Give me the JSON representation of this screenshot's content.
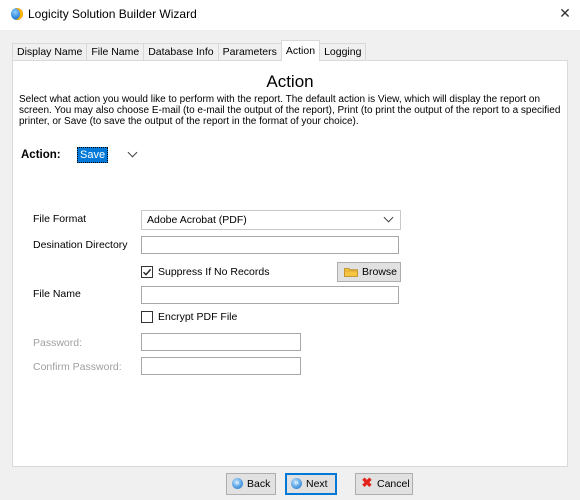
{
  "window": {
    "title": "Logicity Solution Builder Wizard",
    "close_label": "✕"
  },
  "tabs": [
    {
      "label": "Display Name",
      "active": false
    },
    {
      "label": "File Name",
      "active": false
    },
    {
      "label": "Database Info",
      "active": false
    },
    {
      "label": "Parameters",
      "active": false
    },
    {
      "label": "Action",
      "active": true
    },
    {
      "label": "Logging",
      "active": false
    }
  ],
  "panel": {
    "heading": "Action",
    "description": "Select what action you would like to perform with the report.  The default action is View, which will display the report on screen. You may also choose E-mail (to e-mail the output of the report), Print (to print the output of the report to a specified printer, or Save (to save the output of the report in the format of your choice)."
  },
  "action": {
    "label": "Action:",
    "selected": "Save"
  },
  "file_format": {
    "label": "File Format",
    "selected": "Adobe Acrobat (PDF)"
  },
  "destination_directory": {
    "label": "Desination Directory",
    "value": ""
  },
  "suppress": {
    "label": "Suppress If No Records",
    "checked": true
  },
  "browse": {
    "label": "Browse"
  },
  "file_name": {
    "label": "File Name",
    "value": ""
  },
  "encrypt": {
    "label": "Encrypt PDF File",
    "checked": false
  },
  "password": {
    "label": "Password:",
    "value": ""
  },
  "confirm_password": {
    "label": "Confirm Password:",
    "value": ""
  },
  "buttons": {
    "back": "Back",
    "next": "Next",
    "cancel": "Cancel"
  },
  "colors": {
    "selection": "#0078d7",
    "cancel_icon": "#e2231a",
    "disabled_text": "#a0a0a0"
  }
}
